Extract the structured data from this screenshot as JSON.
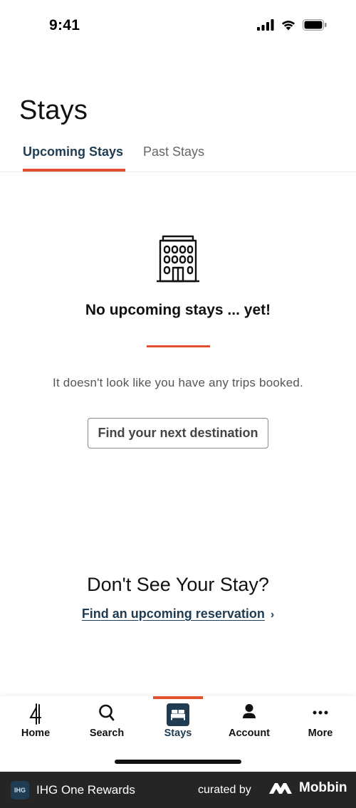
{
  "status_bar": {
    "time": "9:41"
  },
  "page": {
    "title": "Stays"
  },
  "tabs": [
    {
      "label": "Upcoming Stays",
      "active": true
    },
    {
      "label": "Past Stays",
      "active": false
    }
  ],
  "empty_state": {
    "icon": "hotel-building-icon",
    "title": "No upcoming stays ... yet!",
    "description": "It doesn't look like you have any trips booked.",
    "button_label": "Find your next destination"
  },
  "reservation_section": {
    "heading": "Don't See Your Stay?",
    "link_label": "Find an upcoming reservation",
    "link_chevron": "›"
  },
  "bottom_nav": [
    {
      "label": "Home",
      "icon": "ihg-logo-icon",
      "active": false
    },
    {
      "label": "Search",
      "icon": "search-icon",
      "active": false
    },
    {
      "label": "Stays",
      "icon": "bed-icon",
      "active": true
    },
    {
      "label": "Account",
      "icon": "person-icon",
      "active": false
    },
    {
      "label": "More",
      "icon": "more-dots-icon",
      "active": false
    }
  ],
  "footer": {
    "logo_text": "IHG",
    "app_name": "IHG One Rewards",
    "curated_by": "curated by",
    "brand": "Mobbin"
  },
  "colors": {
    "accent": "#e0522e",
    "primary": "#1f3c52",
    "footer_bg": "#252525"
  }
}
